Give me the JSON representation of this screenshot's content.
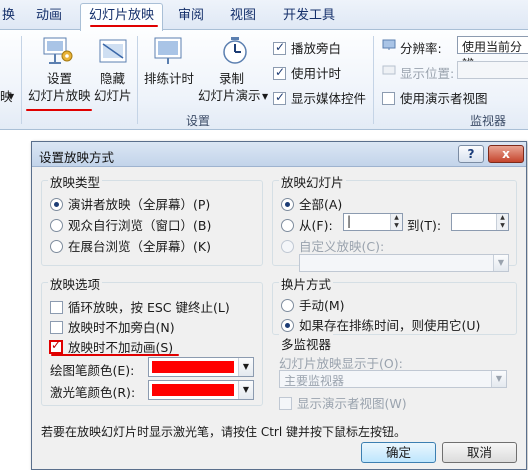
{
  "colors": {
    "annotation": "#e00000",
    "laser": "#ff0000",
    "pen": "#ff0000",
    "accent": "#15306b"
  },
  "ribbon": {
    "tabs": [
      "换",
      "动画",
      "幻灯片放映",
      "审阅",
      "视图",
      "开发工具"
    ],
    "active_tab": "幻灯片放映",
    "btn_setup_line1": "设置",
    "btn_setup_line2": "幻灯片放映",
    "btn_hide_line1": "隐藏",
    "btn_hide_line2": "幻灯片",
    "btn_rehearse": "排练计时",
    "btn_record_line1": "录制",
    "btn_record_line2": "幻灯片演示",
    "chk_narration": "播放旁白",
    "chk_timings": "使用计时",
    "chk_media": "显示媒体控件",
    "resolution_label": "分辨率:",
    "resolution_value": "使用当前分辨",
    "show_on_label": "显示位置:",
    "presenter_view": "使用演示者视图",
    "group_setup": "设置",
    "group_monitors": "监视器",
    "left_fragment": "映"
  },
  "dialog": {
    "title": "设置放映方式",
    "help": "?",
    "close": "x",
    "show_type": {
      "title": "放映类型",
      "presenter": "演讲者放映（全屏幕）(P)",
      "individual": "观众自行浏览（窗口）(B)",
      "kiosk": "在展台浏览（全屏幕）(K)"
    },
    "show_slides": {
      "title": "放映幻灯片",
      "all": "全部(A)",
      "from": "从(F):",
      "to": "到(T):",
      "custom": "自定义放映(C):"
    },
    "show_options": {
      "title": "放映选项",
      "loop": "循环放映，按 ESC 键终止(L)",
      "no_narration": "放映时不加旁白(N)",
      "no_animation": "放映时不加动画(S)",
      "pen_color": "绘图笔颜色(E):",
      "laser_color": "激光笔颜色(R):"
    },
    "advance": {
      "title": "换片方式",
      "manual": "手动(M)",
      "timings": "如果存在排练时间，则使用它(U)"
    },
    "monitors": {
      "title": "多监视器",
      "display_on": "幻灯片放映显示于(O):",
      "primary": "主要监视器",
      "presenter_view": "显示演示者视图(W)"
    },
    "hint": "若要在放映幻灯片时显示激光笔，请按住 Ctrl 键并按下鼠标左按钮。",
    "ok": "确定",
    "cancel": "取消"
  }
}
